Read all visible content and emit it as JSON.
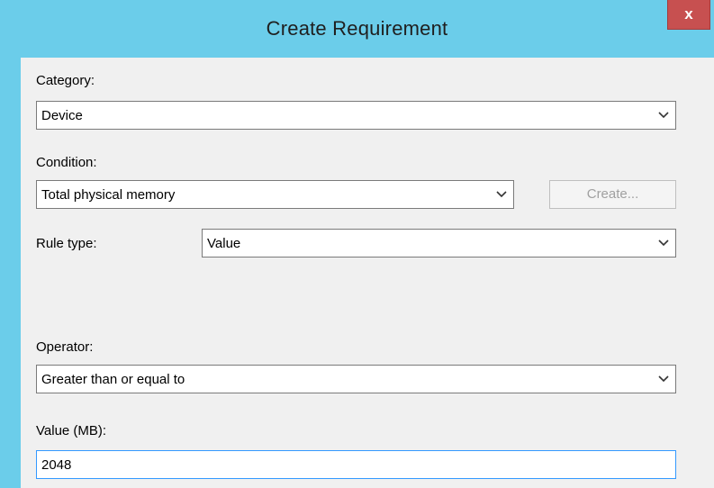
{
  "window": {
    "title": "Create Requirement",
    "close_label": "x"
  },
  "form": {
    "category_label": "Category:",
    "category_value": "Device",
    "condition_label": "Condition:",
    "condition_value": "Total physical memory",
    "create_button_label": "Create...",
    "rule_type_label": "Rule type:",
    "rule_type_value": "Value",
    "operator_label": "Operator:",
    "operator_value": "Greater than or equal to",
    "value_label": "Value (MB):",
    "value_value": "2048"
  },
  "colors": {
    "titlebar": "#6bcdea",
    "close_button": "#c75050",
    "client_background": "#f0f0f0",
    "focus_border": "#3399ff"
  }
}
